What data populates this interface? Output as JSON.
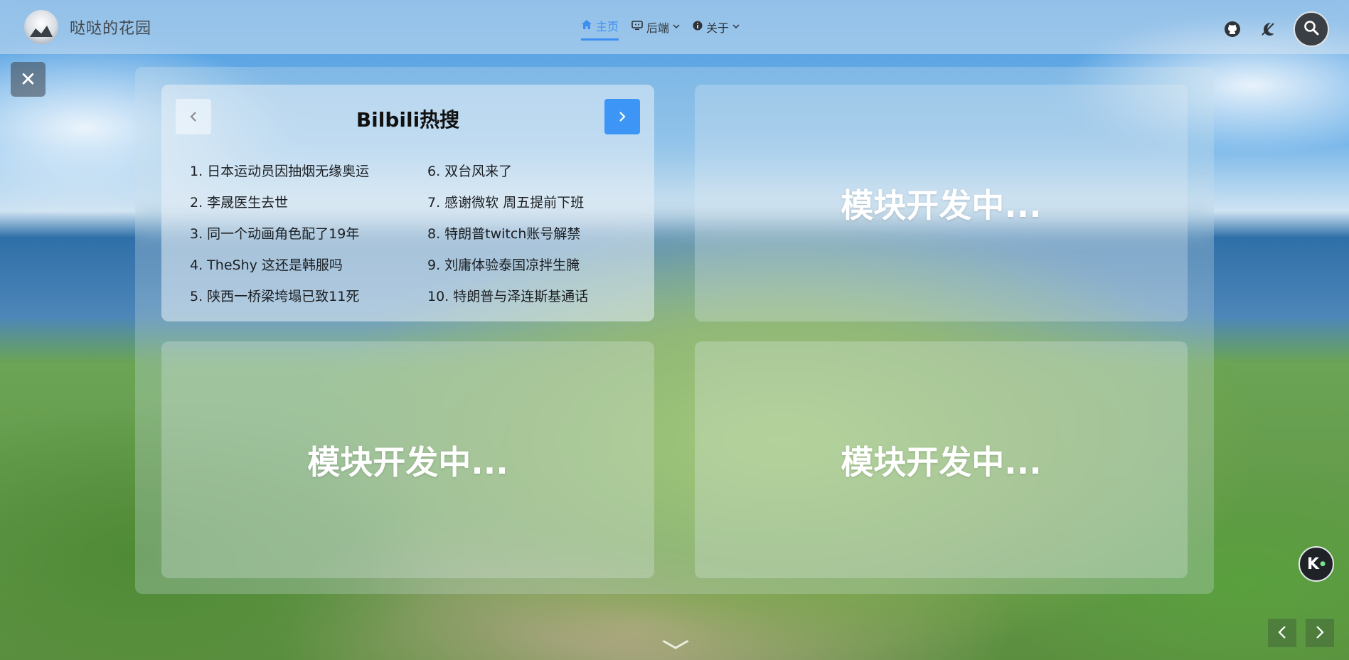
{
  "nav": {
    "site_name": "哒哒的花园",
    "menu": [
      {
        "label": "主页",
        "icon": "home-icon",
        "active": true
      },
      {
        "label": "后端",
        "icon": "monitor-icon",
        "dropdown": true
      },
      {
        "label": "关于",
        "icon": "info-icon",
        "dropdown": true
      }
    ],
    "right_icons": [
      "github-icon",
      "theme-toggle-icon",
      "search-icon"
    ]
  },
  "hot": {
    "title": "Bilbili热搜",
    "items": [
      "1. 日本运动员因抽烟无缘奥运",
      "2. 李晟医生去世",
      "3. 同一个动画角色配了19年",
      "4. TheShy 这还是韩服吗",
      "5. 陕西一桥梁垮塌已致11死",
      "6. 双台风来了",
      "7. 感谢微软 周五提前下班",
      "8. 特朗普twitch账号解禁",
      "9. 刘庸体验泰国凉拌生腌",
      "10. 特朗普与泽连斯基通话"
    ]
  },
  "modules": {
    "dev_text_1": "模块开发中...",
    "dev_text_2": "模块开发中...",
    "dev_text_3": "模块开发中..."
  },
  "floating": {
    "badge_letter": "K"
  },
  "colors": {
    "accent": "#3d8ef0",
    "next_button": "#3d96f5"
  }
}
